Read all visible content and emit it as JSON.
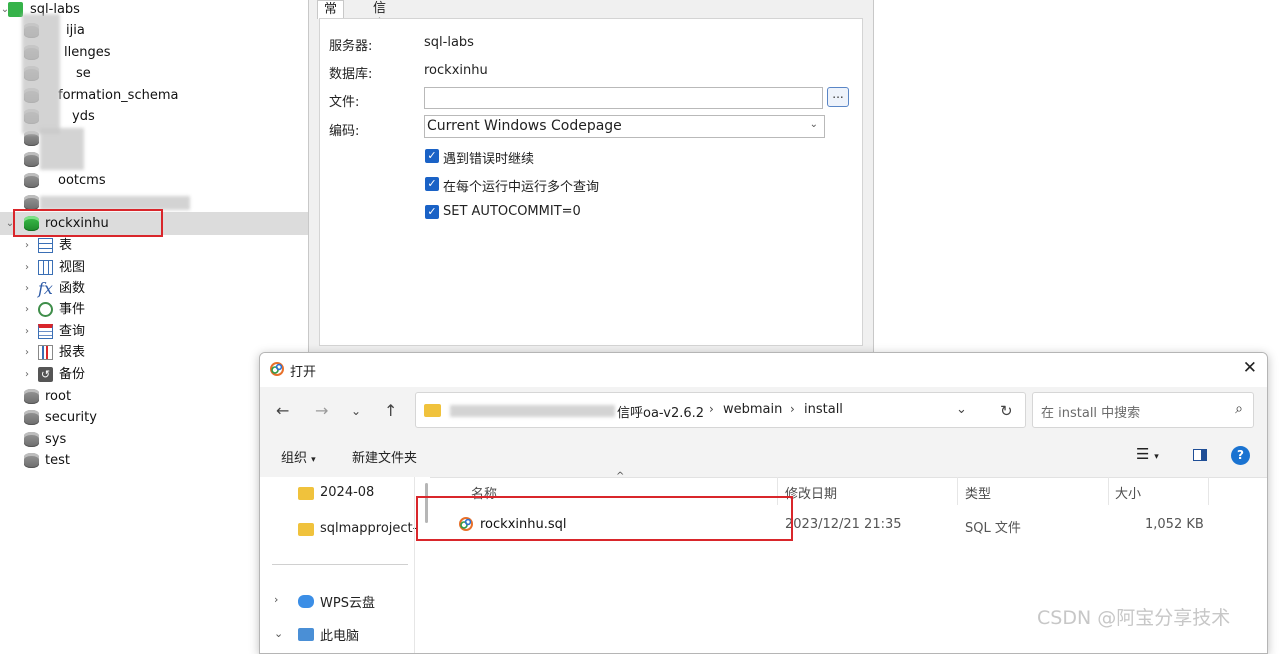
{
  "tree": {
    "connection": "sql-labs",
    "databases": [
      "ijia",
      "llenges",
      "se",
      "formation_schema",
      "yds",
      "",
      "",
      "ootcms",
      ""
    ],
    "selected_db": "rockxinhu",
    "children": [
      "表",
      "视图",
      "函数",
      "事件",
      "查询",
      "报表",
      "备份"
    ],
    "more_dbs": [
      "root",
      "security",
      "sys",
      "test"
    ]
  },
  "settings": {
    "tabs": [
      "常规",
      "信息日志"
    ],
    "server_label": "服务器:",
    "server_value": "sql-labs",
    "db_label": "数据库:",
    "db_value": "rockxinhu",
    "file_label": "文件:",
    "file_value": "",
    "browse_label": "...",
    "encoding_label": "编码:",
    "encoding_value": "Current Windows Codepage",
    "checks": [
      "遇到错误时继续",
      "在每个运行中运行多个查询",
      "SET AUTOCOMMIT=0"
    ]
  },
  "open_dialog": {
    "title": "打开",
    "path": [
      "信呼oa-v2.6.2",
      "webmain",
      "install"
    ],
    "search_placeholder": "在 install 中搜索",
    "organize": "组织",
    "new_folder": "新建文件夹",
    "nav_items": [
      "2024-08",
      "sqlmapproject-",
      "WPS云盘",
      "此电脑"
    ],
    "columns": [
      "名称",
      "修改日期",
      "类型",
      "大小"
    ],
    "files": [
      {
        "name": "rockxinhu.sql",
        "date": "2023/12/21 21:35",
        "type": "SQL 文件",
        "size": "1,052 KB"
      }
    ]
  },
  "watermark": "CSDN @阿宝分享技术",
  "colors": {
    "highlight": "#d9262b",
    "checkbox": "#1a62c6",
    "folder": "#f0c23c",
    "db_active": "#2aa63a"
  }
}
